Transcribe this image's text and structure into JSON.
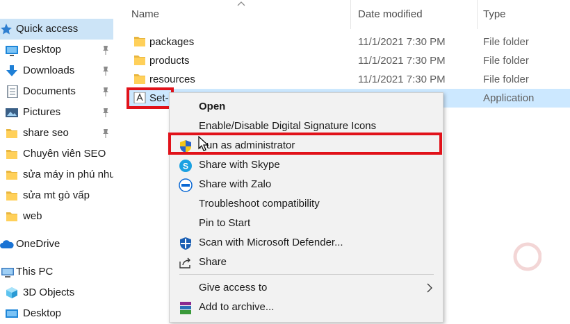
{
  "nav": {
    "quick_access": "Quick access",
    "items": [
      {
        "label": "Desktop",
        "icon": "desktop-icon",
        "pinned": true
      },
      {
        "label": "Downloads",
        "icon": "download-arrow-icon",
        "pinned": true
      },
      {
        "label": "Documents",
        "icon": "documents-icon",
        "pinned": true
      },
      {
        "label": "Pictures",
        "icon": "pictures-icon",
        "pinned": true
      },
      {
        "label": "share seo",
        "icon": "folder-icon",
        "pinned": true
      },
      {
        "label": "Chuyên viên SEO",
        "icon": "folder-icon",
        "pinned": false
      },
      {
        "label": "sửa máy in phú nhuận",
        "icon": "folder-icon",
        "pinned": false
      },
      {
        "label": "sửa mt gò vấp",
        "icon": "folder-icon",
        "pinned": false
      },
      {
        "label": "web",
        "icon": "folder-icon",
        "pinned": false
      }
    ],
    "onedrive": "OneDrive",
    "this_pc": "This PC",
    "pc_items": [
      {
        "label": "3D Objects",
        "icon": "3d-objects-icon"
      },
      {
        "label": "Desktop",
        "icon": "desktop-icon"
      }
    ]
  },
  "columns": {
    "name": "Name",
    "date": "Date modified",
    "type": "Type"
  },
  "files": [
    {
      "name": "packages",
      "date": "11/1/2021 7:30 PM",
      "type": "File folder",
      "icon": "folder-icon"
    },
    {
      "name": "products",
      "date": "11/1/2021 7:30 PM",
      "type": "File folder",
      "icon": "folder-icon"
    },
    {
      "name": "resources",
      "date": "11/1/2021 7:30 PM",
      "type": "File folder",
      "icon": "folder-icon"
    },
    {
      "name": "Set-",
      "date": "",
      "type": "Application",
      "icon": "adobe-app-icon",
      "selected": true
    }
  ],
  "context_menu": {
    "items": [
      {
        "label": "Open",
        "bold": true,
        "icon": ""
      },
      {
        "label": "Enable/Disable Digital Signature Icons",
        "icon": ""
      },
      {
        "label": "Run as administrator",
        "icon": "uac-shield-icon",
        "highlighted": true
      },
      {
        "label": "Share with Skype",
        "icon": "skype-icon"
      },
      {
        "label": "Share with Zalo",
        "icon": "zalo-icon"
      },
      {
        "label": "Troubleshoot compatibility",
        "icon": ""
      },
      {
        "label": "Pin to Start",
        "icon": ""
      },
      {
        "label": "Scan with Microsoft Defender...",
        "icon": "defender-icon"
      },
      {
        "label": "Share",
        "icon": "share-icon"
      },
      {
        "label": "Give access to",
        "icon": "",
        "submenu": true
      },
      {
        "label": "Add to archive...",
        "icon": "winrar-icon"
      }
    ]
  },
  "colors": {
    "highlight_red": "#e1121a",
    "selection_blue": "#cce8ff",
    "quick_access_bg": "#cce4f7"
  }
}
